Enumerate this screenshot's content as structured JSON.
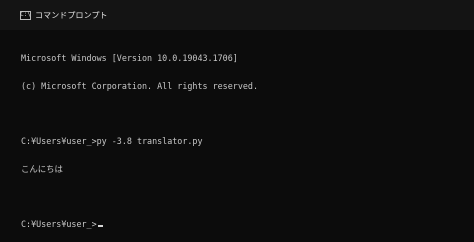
{
  "window": {
    "title": "コマンドプロンプト",
    "icon": "command-prompt-icon",
    "icon_glyph": "C:\\"
  },
  "console": {
    "lines": [
      "Microsoft Windows [Version 10.0.19043.1706]",
      "(c) Microsoft Corporation. All rights reserved.",
      "",
      "C:¥Users¥user_>py -3.8 translator.py",
      "こんにちは",
      "",
      "C:¥Users¥user_>"
    ]
  },
  "colors": {
    "background": "#0c0c0c",
    "titlebar": "#141414",
    "text": "#c8c8c8"
  }
}
